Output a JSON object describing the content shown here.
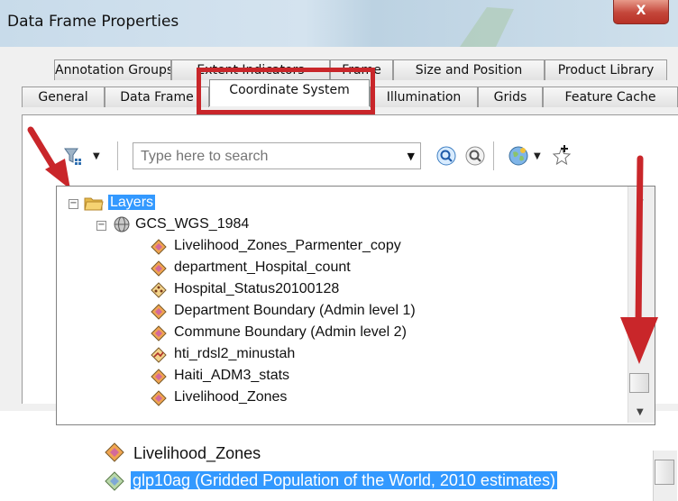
{
  "window": {
    "title": "Data Frame Properties",
    "close_glyph": "X"
  },
  "tabs": {
    "top_row": [
      {
        "label": "Annotation Groups"
      },
      {
        "label": "Extent Indicators"
      },
      {
        "label": "Frame"
      },
      {
        "label": "Size and Position"
      },
      {
        "label": "Product Library"
      }
    ],
    "bottom_row": [
      {
        "label": "General"
      },
      {
        "label": "Data Frame"
      },
      {
        "label": "Coordinate System",
        "active": true
      },
      {
        "label": "Illumination"
      },
      {
        "label": "Grids"
      },
      {
        "label": "Feature Cache"
      }
    ]
  },
  "toolbar": {
    "search_placeholder": "Type here to search",
    "icons": [
      "filter-icon",
      "search-icon",
      "search-options-icon",
      "globe-icon",
      "add-favorite-icon"
    ]
  },
  "tree": {
    "root": {
      "label": "Layers",
      "icon": "folder-icon",
      "selected": true
    },
    "group": {
      "label": "GCS_WGS_1984",
      "icon": "globe-icon"
    },
    "items": [
      {
        "label": "Livelihood_Zones_Parmenter_copy",
        "icon": "polygon-layer-icon"
      },
      {
        "label": "department_Hospital_count",
        "icon": "polygon-layer-icon"
      },
      {
        "label": "Hospital_Status20100128",
        "icon": "point-layer-icon"
      },
      {
        "label": "Department Boundary (Admin level 1)",
        "icon": "polygon-layer-icon"
      },
      {
        "label": "Commune Boundary (Admin level 2)",
        "icon": "polygon-layer-icon"
      },
      {
        "label": "hti_rdsl2_minustah",
        "icon": "line-layer-icon"
      },
      {
        "label": "Haiti_ADM3_stats",
        "icon": "polygon-layer-icon"
      },
      {
        "label": "Livelihood_Zones",
        "icon": "polygon-layer-icon"
      }
    ]
  },
  "bottom": {
    "items": [
      {
        "label": "Livelihood_Zones",
        "icon": "polygon-layer-icon"
      },
      {
        "label": "glp10ag (Gridded Population of the World, 2010 estimates)",
        "icon": "raster-layer-icon",
        "selected": true
      }
    ]
  },
  "colors": {
    "highlight": "#c9262a",
    "selection": "#3399ff"
  }
}
